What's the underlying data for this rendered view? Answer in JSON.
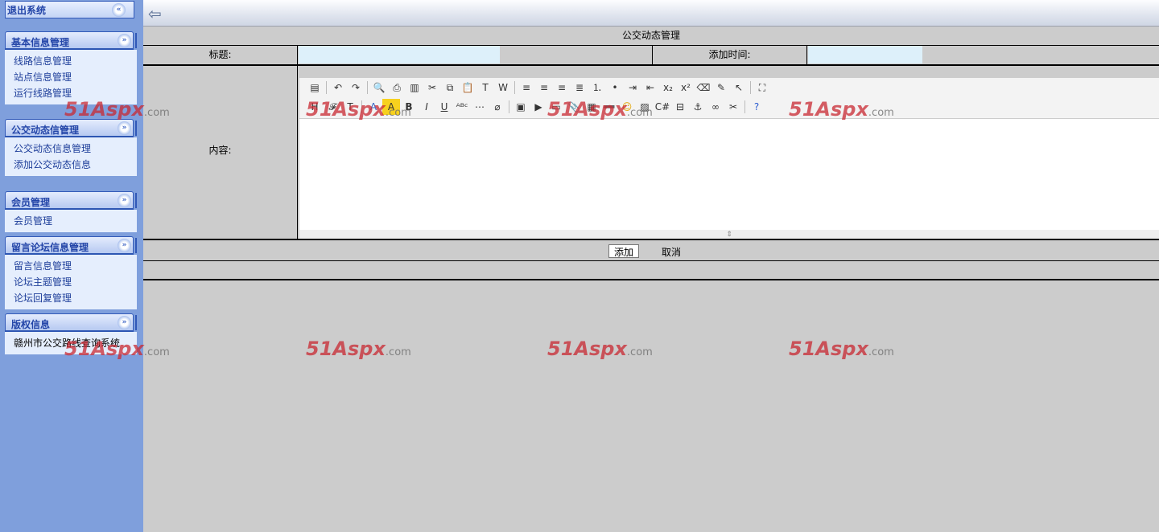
{
  "sidebar": {
    "logout": "退出系统",
    "panels": [
      {
        "title": "基本信息管理",
        "items": [
          "线路信息管理",
          "站点信息管理",
          "运行线路管理"
        ]
      },
      {
        "title": "公交动态信管理",
        "items": [
          "公交动态信息管理",
          "添加公交动态信息"
        ]
      },
      {
        "title": "会员管理",
        "items": [
          "会员管理"
        ]
      },
      {
        "title": "留言论坛信息管理",
        "items": [
          "留言信息管理",
          "论坛主题管理",
          "论坛回复管理"
        ]
      },
      {
        "title": "版权信息",
        "items": [
          "赣州市公交路线查询系统"
        ]
      }
    ]
  },
  "form": {
    "title": "公交动态管理",
    "title_label": "标题:",
    "time_label": "添加时间:",
    "content_label": "内容:",
    "title_value": "",
    "time_value": "",
    "add_button": "添加",
    "cancel_button": "取消"
  },
  "toolbar": {
    "row1": [
      "source",
      "|",
      "undo",
      "redo",
      "|",
      "preview",
      "print",
      "template",
      "cut",
      "copy",
      "paste",
      "paste-text",
      "paste-word",
      "|",
      "align-left",
      "align-center",
      "align-right",
      "justify",
      "ordered-list",
      "unordered-list",
      "indent",
      "outdent",
      "subscript",
      "superscript",
      "clear-format",
      "select-all",
      "select",
      "|",
      "fullscreen"
    ],
    "row2": [
      "heading",
      "font-family",
      "font-size",
      "|",
      "font-color",
      "highlight-color",
      "bold",
      "italic",
      "underline",
      "strikethrough",
      "horizontal-line",
      "remove-format",
      "|",
      "flash",
      "media",
      "file",
      "attachment",
      "table",
      "hr",
      "emoticon",
      "image",
      "code",
      "pagebreak",
      "anchor",
      "link",
      "unlink",
      "|",
      "about"
    ]
  },
  "watermark": "51Aspx",
  "watermark_suffix": ".com"
}
